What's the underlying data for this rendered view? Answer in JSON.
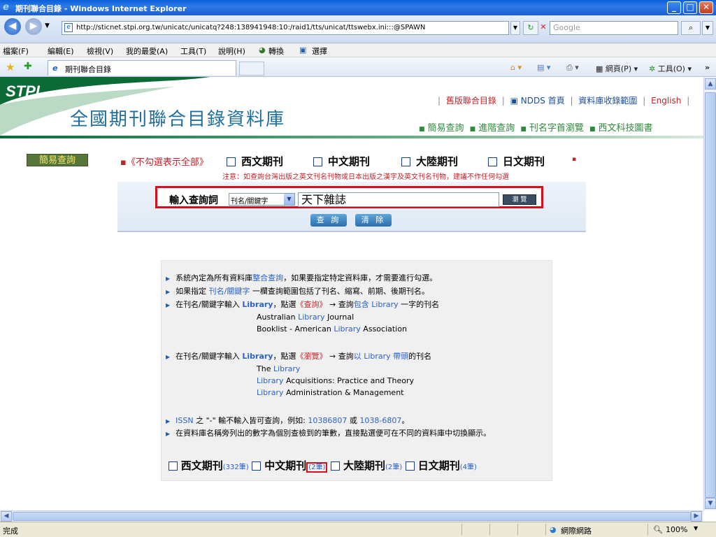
{
  "window": {
    "title": "期刊聯合目錄 - Windows Internet Explorer",
    "minimize": "_",
    "maximize": "□",
    "close": "✕"
  },
  "address_bar": {
    "url": "http://sticnet.stpi.org.tw/unicatc/unicatq?248:138941948:10:/raid1/tts/unicat/ttswebx.ini:::@SPAWN",
    "search_placeholder": "Google"
  },
  "menu": [
    "檔案(F)",
    "編輯(E)",
    "檢視(V)",
    "我的最愛(A)",
    "工具(T)",
    "說明(H)",
    "轉換",
    "選擇"
  ],
  "tab": {
    "label": "期刊聯合目錄"
  },
  "command_bar": [
    "網頁(P)",
    "工具(O)"
  ],
  "site": {
    "logo": "STPI",
    "title": "全國期刊聯合目錄資料庫",
    "top_links": [
      "舊版聯合目錄",
      "NDDS 首頁",
      "資料庫收錄範圍",
      "English"
    ],
    "sub_nav": [
      "簡易查詢",
      "進階查詢",
      "刊名字首瀏覽",
      "西文科技圖書"
    ]
  },
  "search": {
    "mode_button": "簡易查詢",
    "filter_hint": "《不勾選表示全部》",
    "categories": [
      "西文期刊",
      "中文期刊",
      "大陸期刊",
      "日文期刊"
    ],
    "note": "注意：如查詢台灣出版之英文刊名刊物或日本出版之漢字及英文刊名刊物，建議不作任何勾選",
    "query_label": "輸入查詢詞",
    "field_select": "刊名/關鍵字",
    "query_value": "天下雜誌",
    "browse_button": "瀏 覽",
    "search_button": "查 詢",
    "clear_button": "清 除"
  },
  "help": {
    "line1_a": "系統內定為所有資料庫",
    "line1_b": "整合查詢",
    "line1_c": "，如果要指定特定資料庫，才需要進行勾選。",
    "line2_a": "如果指定",
    "line2_b": "刊名/關鍵字",
    "line2_c": "一欄查詢範圍包括了刊名、縮寫、前期、後期刊名。",
    "line3_a": "在刊名/關鍵字輸入",
    "line3_b": "Library",
    "line3_c": "，點選",
    "line3_d": "《查詢》",
    "line3_e": "→ 查詢",
    "line3_f": "包含 Library",
    "line3_g": "一字的刊名",
    "ex1": [
      [
        "Australian ",
        "Library",
        " Journal"
      ],
      [
        "Booklist - American ",
        "Library",
        " Association"
      ]
    ],
    "line4_a": "在刊名/關鍵字輸入",
    "line4_b": "Library",
    "line4_c": "，點選",
    "line4_d": "《瀏覽》",
    "line4_e": "→ 查詢",
    "line4_f": "以 Library 帶頭",
    "line4_g": "的刊名",
    "ex2": [
      [
        "The ",
        "Library",
        ""
      ],
      [
        "",
        "Library",
        " Acquisitions: Practice and Theory"
      ],
      [
        "",
        "Library",
        " Administration & Management"
      ]
    ],
    "line5_a": "ISSN",
    "line5_b": "之 \"-\" 輸不輸入皆可查詢，例如:",
    "line5_c": "10386807",
    "line5_d": "或",
    "line5_e": "1038-6807",
    "line5_f": "。",
    "line6": "在資料庫名稱旁列出的數字為個別查檢到的筆數，直接點選便可在不同的資料庫中切換顯示。"
  },
  "counts": [
    {
      "name": "西文期刊",
      "count": "(332筆)"
    },
    {
      "name": "中文期刊",
      "count": "(2筆)"
    },
    {
      "name": "大陸期刊",
      "count": "(2筆)"
    },
    {
      "name": "日文期刊",
      "count": "(4筆)"
    }
  ],
  "status": {
    "text": "完成",
    "zone": "網際網路",
    "zoom": "100%"
  }
}
